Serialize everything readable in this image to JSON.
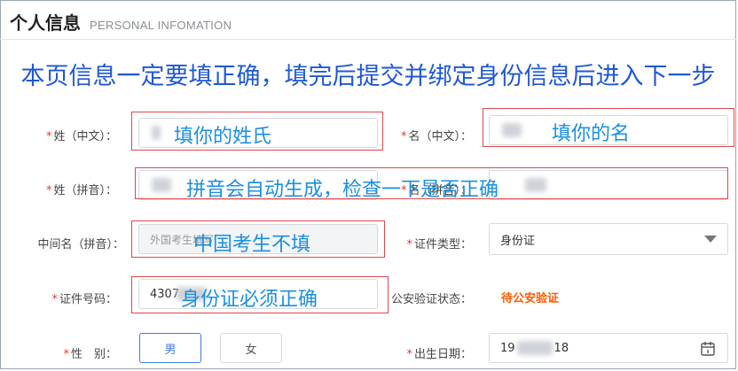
{
  "header": {
    "title": "个人信息",
    "subtitle": "PERSONAL INFOMATION"
  },
  "banner": "本页信息一定要填正确，填完后提交并绑定身份信息后进入下一步",
  "fields": {
    "surname_cn": {
      "required": "*",
      "label": "姓（中文）：",
      "annotation": "填你的姓氏"
    },
    "givenname_cn": {
      "required": "*",
      "label": "名（中文）：",
      "annotation": "填你的名"
    },
    "surname_pinyin": {
      "required": "*",
      "label": "姓（拼音）：",
      "annotation": "拼音会自动生成，检查一下是否正确"
    },
    "givenname_pinyin": {
      "required": "*",
      "label": "名（拼音）："
    },
    "middlename": {
      "label": "中间名（拼音）：",
      "placeholder": "外国考生填写",
      "annotation": "中国考生不填"
    },
    "id_type": {
      "required": "*",
      "label": "证件类型：",
      "value": "身份证"
    },
    "id_number": {
      "required": "*",
      "label": "证件号码：",
      "value": "4307",
      "annotation": "身份证必须正确"
    },
    "police_status": {
      "label": "公安验证状态：",
      "value": "待公安验证"
    },
    "gender": {
      "required": "*",
      "label": "性　别：",
      "options": [
        "男",
        "女"
      ],
      "selected": "男"
    },
    "birthdate": {
      "required": "*",
      "label": "出生日期：",
      "value_start": "19",
      "value_end": "18"
    }
  },
  "colors": {
    "annotation": "#1a8fe0",
    "banner": "#1f58d4",
    "highlight_box": "#e0464b",
    "status": "#ff5a00",
    "required": "#e53935",
    "selected": "#3c7be8"
  },
  "icons": {
    "select": "caret-down-icon",
    "date": "calendar-icon"
  }
}
